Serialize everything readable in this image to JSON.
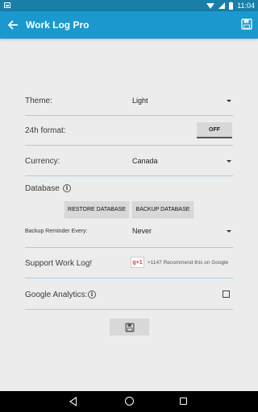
{
  "status_bar": {
    "time": "11:04"
  },
  "app_bar": {
    "title": "Work Log Pro",
    "back_icon": "arrow-left-icon",
    "save_icon": "floppy-disk-icon"
  },
  "settings": {
    "theme": {
      "label": "Theme:",
      "value": "Light"
    },
    "format24h": {
      "label": "24h format:",
      "toggle": "OFF"
    },
    "currency": {
      "label": "Currency:",
      "value": "Canada"
    },
    "database": {
      "label": "Database",
      "restore_label": "RESTORE DATABASE",
      "backup_label": "BACKUP DATABASE"
    },
    "backup_reminder": {
      "label": "Backup Reminder Every:",
      "value": "Never"
    },
    "support": {
      "label": "Support Work Log!",
      "gplus_button": "g+1",
      "gplus_text": "+1147 Recommend this on Google"
    },
    "analytics": {
      "label": "Google Analytics:",
      "checked": false
    }
  },
  "colors": {
    "status_bar": "#187fa8",
    "app_bar": "#1b99cf",
    "divider": "#9fcfe6",
    "background": "#ececec"
  }
}
